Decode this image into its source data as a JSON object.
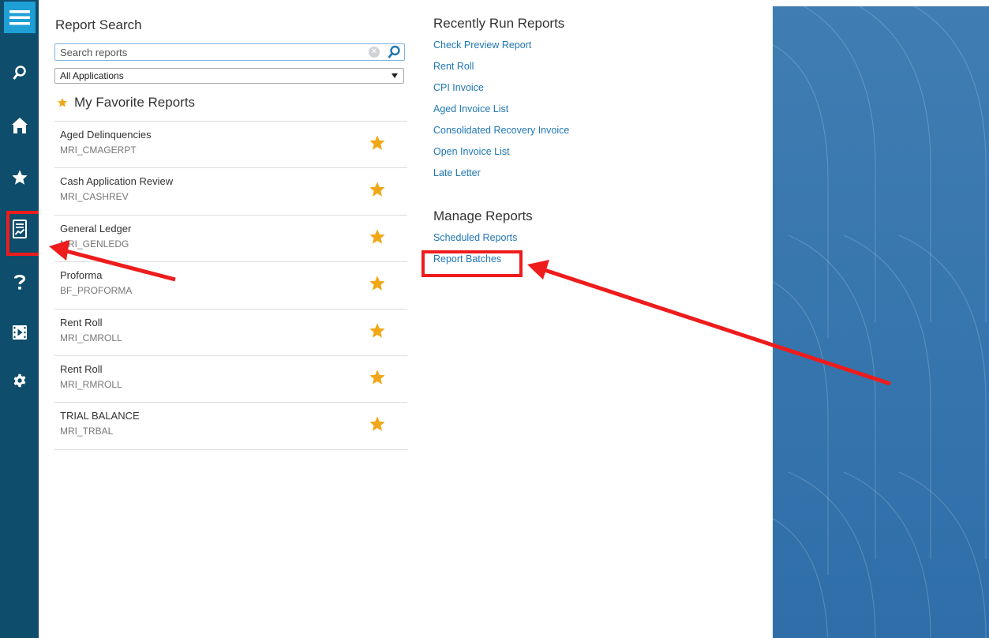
{
  "search": {
    "title": "Report Search",
    "placeholder": "Search reports",
    "application_filter": "All Applications"
  },
  "favorites": {
    "title": "My Favorite Reports",
    "items": [
      {
        "name": "Aged Delinquencies",
        "code": "MRI_CMAGERPT"
      },
      {
        "name": "Cash Application Review",
        "code": "MRI_CASHREV"
      },
      {
        "name": "General Ledger",
        "code": "MRI_GENLEDG"
      },
      {
        "name": "Proforma",
        "code": "BF_PROFORMA"
      },
      {
        "name": "Rent Roll",
        "code": "MRI_CMROLL"
      },
      {
        "name": "Rent Roll",
        "code": "MRI_RMROLL"
      },
      {
        "name": "TRIAL BALANCE",
        "code": "MRI_TRBAL"
      }
    ]
  },
  "recent": {
    "title": "Recently Run Reports",
    "items": [
      "Check Preview Report",
      "Rent Roll",
      "CPI Invoice",
      "Aged Invoice List",
      "Consolidated Recovery Invoice",
      "Open Invoice List",
      "Late Letter"
    ]
  },
  "manage": {
    "title": "Manage Reports",
    "items": [
      "Scheduled Reports",
      "Report Batches"
    ]
  },
  "colors": {
    "sidebar": "#0e4d6b",
    "menu_button": "#1e9fd6",
    "link": "#1f77b4",
    "star": "#f0a818",
    "annotation": "#ee1c1c",
    "right_panel": "#3474ad"
  },
  "icons": [
    "menu-icon",
    "search-icon",
    "home-icon",
    "star-icon",
    "reports-icon",
    "help-icon",
    "video-icon",
    "gear-icon"
  ]
}
